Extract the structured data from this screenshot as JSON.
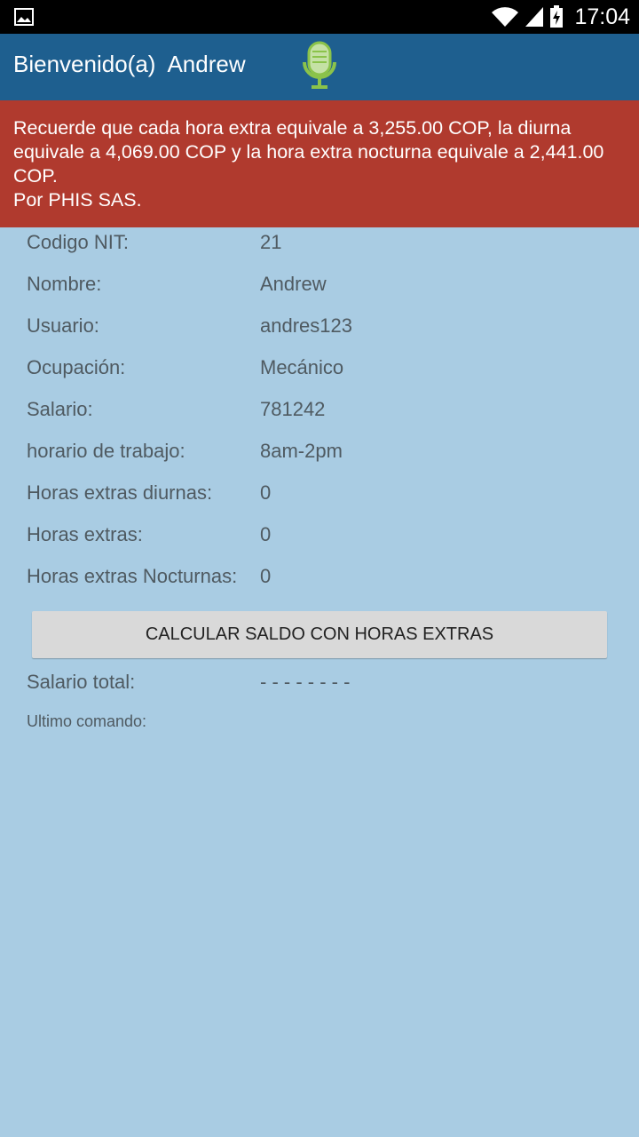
{
  "status_bar": {
    "time": "17:04",
    "icons": [
      "image-icon",
      "wifi-icon",
      "signal-icon",
      "battery-charging-icon"
    ]
  },
  "app_bar": {
    "title": "Bienvenido(a)  Andrew",
    "mic_icon": "microphone-icon"
  },
  "banner": {
    "message": "Recuerde que cada hora extra equivale a 3,255.00 COP, la diurna equivale a 4,069.00 COP y la hora extra nocturna equivale a 2,441.00 COP.",
    "signature": "Por PHIS SAS."
  },
  "fields": [
    {
      "label": "Codigo NIT:",
      "value": "21"
    },
    {
      "label": "Nombre:",
      "value": "Andrew"
    },
    {
      "label": "Usuario:",
      "value": "andres123"
    },
    {
      "label": "Ocupación:",
      "value": "Mecánico"
    },
    {
      "label": "Salario:",
      "value": "781242"
    },
    {
      "label": "horario de trabajo:",
      "value": "8am-2pm"
    },
    {
      "label": "Horas extras diurnas:",
      "value": "0"
    },
    {
      "label": "Horas extras:",
      "value": "0"
    },
    {
      "label": "Horas extras Nocturnas:",
      "value": "0"
    }
  ],
  "calculate_button": "CALCULAR SALDO CON HORAS EXTRAS",
  "total": {
    "label": "Salario total:",
    "value": "- - - - - - - -"
  },
  "last_command": {
    "label": "Ultimo comando:"
  },
  "colors": {
    "background": "#a9cce3",
    "app_bar": "#1e5f8f",
    "banner": "#b03a2e",
    "mic_green": "#8bc34a"
  }
}
